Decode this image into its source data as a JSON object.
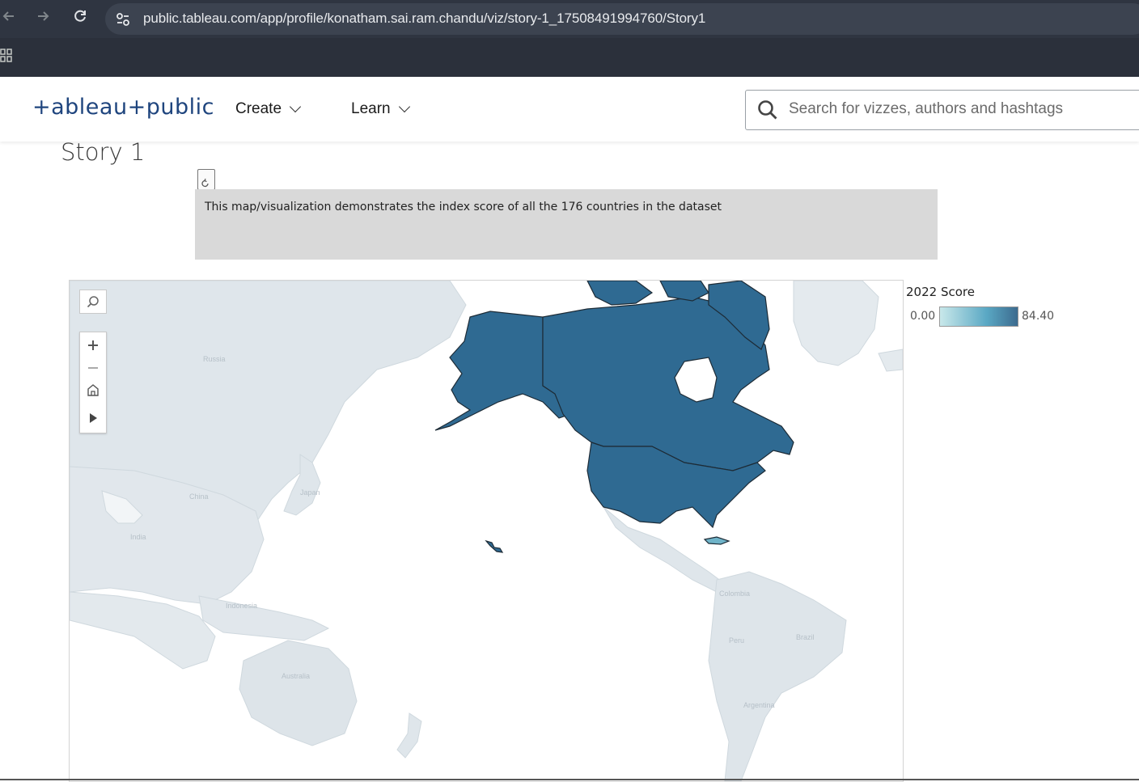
{
  "browser": {
    "url": "public.tableau.com/app/profile/konatham.sai.ram.chandu/viz/story-1_17508491994760/Story1",
    "back_icon": "arrow-left-icon",
    "forward_icon": "arrow-right-icon",
    "reload_icon": "reload-icon",
    "site_info_icon": "tune-icon",
    "apps_icon": "apps-grid-icon"
  },
  "header": {
    "logo": "+ableau+public",
    "menu": [
      {
        "label": "Create",
        "icon": "chevron-down-icon"
      },
      {
        "label": "Learn",
        "icon": "chevron-down-icon"
      }
    ],
    "search": {
      "placeholder": "Search for vizzes, authors and hashtags",
      "icon": "search-icon"
    }
  },
  "story": {
    "title": "Story 1",
    "caption": "This map/visualization demonstrates the index score of all the 176 countries in the dataset"
  },
  "map": {
    "highlight_color": "#2f6a92",
    "base_land_color": "#dfe6eb",
    "ocean_color": "#ffffff",
    "labels": {
      "russia": "Russia",
      "china": "China",
      "japan": "Japan",
      "india": "India",
      "indonesia": "Indonesia",
      "australia": "Australia",
      "colombia": "Colombia",
      "peru": "Peru",
      "brazil": "Brazil",
      "argentina": "Argentina"
    },
    "tools": [
      "search-icon",
      "zoom-in-icon",
      "zoom-out-icon",
      "home-icon",
      "play-icon"
    ]
  },
  "legend": {
    "title": "2022 Score",
    "min": "0.00",
    "max": "84.40",
    "color_low": "#c9e8ea",
    "color_mid": "#5aa8c4",
    "color_high": "#3c6b8f"
  }
}
